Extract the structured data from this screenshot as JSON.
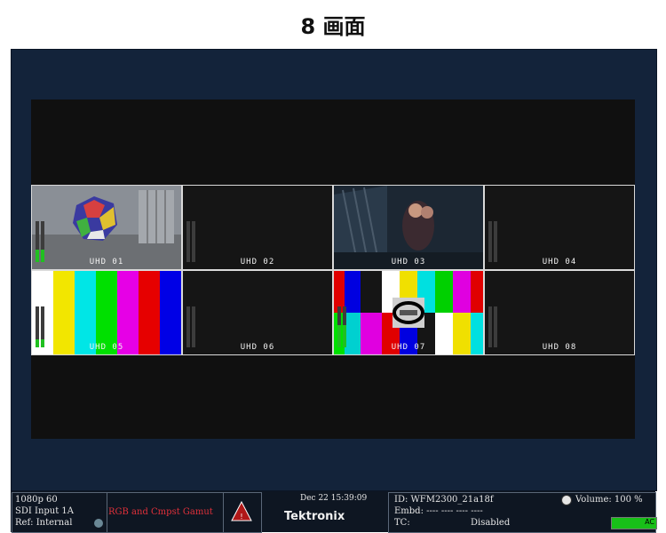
{
  "title": "8 画面",
  "tiles": [
    {
      "label": "UHD 01",
      "meter1": 0.3,
      "meter2": 0.3
    },
    {
      "label": "UHD 02",
      "meter1": 0.0,
      "meter2": 0.0
    },
    {
      "label": "UHD 03",
      "meter1": 0.0,
      "meter2": 0.0
    },
    {
      "label": "UHD 04",
      "meter1": 0.0,
      "meter2": 0.0
    },
    {
      "label": "UHD 05",
      "meter1": 0.2,
      "meter2": 0.2
    },
    {
      "label": "UHD 06",
      "meter1": 0.0,
      "meter2": 0.0
    },
    {
      "label": "UHD 07",
      "meter1": 0.55,
      "meter2": 0.55
    },
    {
      "label": "UHD 08",
      "meter1": 0.0,
      "meter2": 0.0
    }
  ],
  "colors": {
    "bars": [
      "#ffffff",
      "#f2e600",
      "#00e6e6",
      "#00e000",
      "#e600e6",
      "#e60000",
      "#0000e6"
    ],
    "meter": "#20c020"
  },
  "status": {
    "format": "1080p 60",
    "input": "SDI Input 1A",
    "ref": "Ref: Internal",
    "gamut": "RGB and Cmpst Gamut",
    "datetime": "Dec 22 15:39:09",
    "brand": "Tektronix",
    "id": "ID: WFM2300_21a18f",
    "embd": "Embd: ---- ---- ---- ----",
    "tc_label": "TC:",
    "tc_value": "Disabled",
    "volume": "Volume: 100 %",
    "volume_level": 1.0,
    "volume_bar_text": "AC"
  }
}
